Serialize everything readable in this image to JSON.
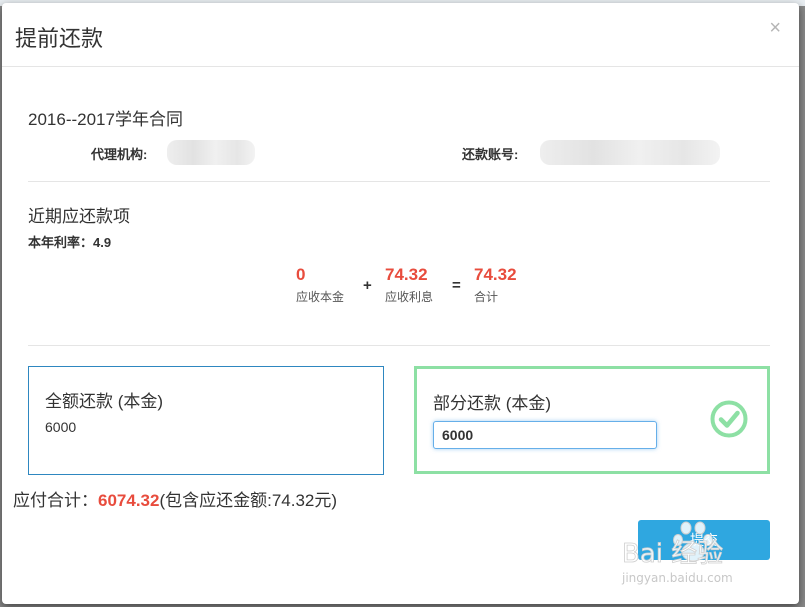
{
  "modal": {
    "title": "提前还款",
    "close_label": "×"
  },
  "contract": {
    "title": "2016--2017学年合同",
    "agency_label": "代理机构:",
    "account_label": "还款账号:"
  },
  "recent": {
    "title": "近期应还款项",
    "rate_label": "本年利率：",
    "rate_value": "4.9",
    "principal_value": "0",
    "principal_label": "应收本金",
    "plus": "+",
    "interest_value": "74.32",
    "interest_label": "应收利息",
    "equals": "=",
    "total_value": "74.32",
    "total_label": "合计"
  },
  "options": {
    "full": {
      "title": "全额还款 (本金)",
      "amount": "6000"
    },
    "partial": {
      "title": "部分还款 (本金)",
      "input_value": "6000",
      "selected": true
    }
  },
  "summary": {
    "label": "应付合计：",
    "amount": "6074.32",
    "note": "(包含应还金额:74.32元)"
  },
  "submit_label": "提交",
  "watermark": {
    "logo_text": "Bai  经验",
    "url": "jingyan.baidu.com"
  },
  "colors": {
    "accent_red": "#e84c3d",
    "selected_green": "#8de0a4",
    "primary_blue": "#2fa7e0"
  }
}
